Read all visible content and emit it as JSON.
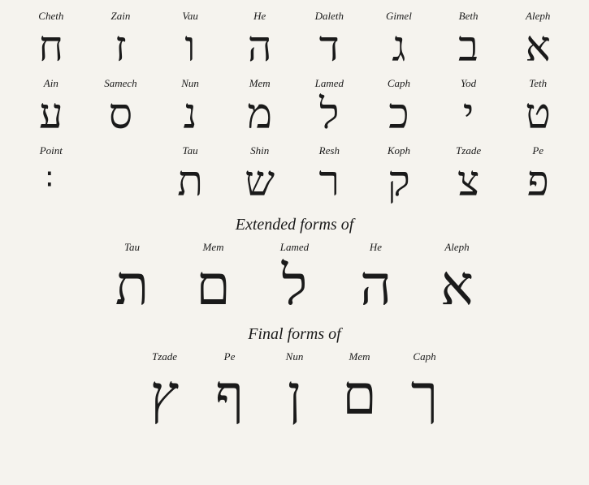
{
  "rows": [
    {
      "id": "row1",
      "letters": [
        {
          "name": "Cheth",
          "glyph": "ח"
        },
        {
          "name": "Zain",
          "glyph": "ז"
        },
        {
          "name": "Vau",
          "glyph": "ו"
        },
        {
          "name": "He",
          "glyph": "ה"
        },
        {
          "name": "Daleth",
          "glyph": "ד"
        },
        {
          "name": "Gimel",
          "glyph": "ג"
        },
        {
          "name": "Beth",
          "glyph": "ב"
        },
        {
          "name": "Aleph",
          "glyph": "א"
        }
      ]
    },
    {
      "id": "row2",
      "letters": [
        {
          "name": "Ain",
          "glyph": "ע"
        },
        {
          "name": "Samech",
          "glyph": "ס"
        },
        {
          "name": "Nun",
          "glyph": "נ"
        },
        {
          "name": "Mem",
          "glyph": "מ"
        },
        {
          "name": "Lamed",
          "glyph": "ל"
        },
        {
          "name": "Caph",
          "glyph": "כ"
        },
        {
          "name": "Yod",
          "glyph": "י"
        },
        {
          "name": "Teth",
          "glyph": "ט"
        }
      ]
    },
    {
      "id": "row3",
      "letters": [
        {
          "name": "Point",
          "glyph": ":",
          "isPoint": true
        },
        {
          "name": "",
          "glyph": ""
        },
        {
          "name": "Tau",
          "glyph": "ת"
        },
        {
          "name": "Shin",
          "glyph": "ש"
        },
        {
          "name": "Resh",
          "glyph": "ר"
        },
        {
          "name": "Koph",
          "glyph": "ק"
        },
        {
          "name": "Tzade",
          "glyph": "צ"
        },
        {
          "name": "Pe",
          "glyph": "פ"
        }
      ]
    }
  ],
  "extended": {
    "title": "Extended forms of",
    "letters": [
      {
        "name": "Tau",
        "glyph": "ת"
      },
      {
        "name": "Mem",
        "glyph": "ם"
      },
      {
        "name": "Lamed",
        "glyph": "ל"
      },
      {
        "name": "He",
        "glyph": "ה"
      },
      {
        "name": "Aleph",
        "glyph": "א"
      }
    ]
  },
  "final": {
    "title": "Final forms of",
    "letters": [
      {
        "name": "Tzade",
        "glyph": "ץ"
      },
      {
        "name": "Pe",
        "glyph": "ף"
      },
      {
        "name": "Nun",
        "glyph": "ן"
      },
      {
        "name": "Mem",
        "glyph": "ם"
      },
      {
        "name": "Caph",
        "glyph": "ך"
      }
    ]
  }
}
